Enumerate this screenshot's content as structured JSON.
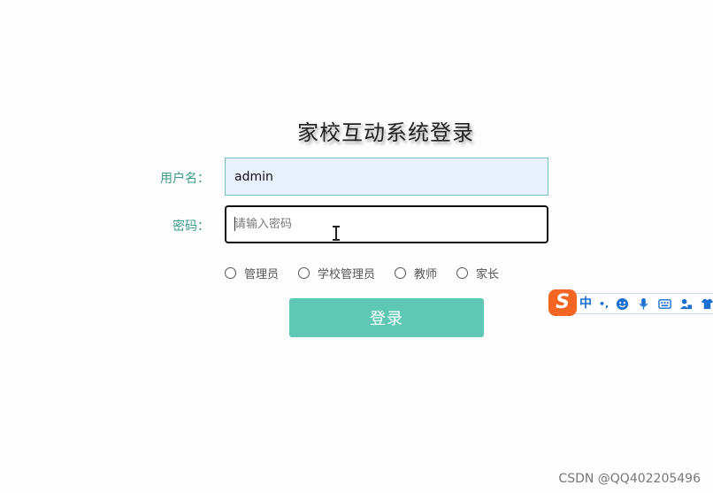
{
  "page": {
    "title": "家校互动系统登录"
  },
  "form": {
    "username_label": "用户名：",
    "username_value": "admin",
    "password_label": "密码：",
    "password_placeholder": "请输入密码",
    "password_value": ""
  },
  "roles": [
    {
      "label": "管理员",
      "checked": false
    },
    {
      "label": "学校管理员",
      "checked": false
    },
    {
      "label": "教师",
      "checked": false
    },
    {
      "label": "家长",
      "checked": false
    }
  ],
  "login_button": {
    "label": "登录"
  },
  "ime_toolbar": {
    "logo": "S",
    "mode": "中",
    "punct": "•,",
    "icons": [
      "emoji-icon",
      "microphone-icon",
      "keyboard-icon",
      "user-skin-icon",
      "shirt-icon"
    ]
  },
  "colors": {
    "accent": "#5ec8b4",
    "label_teal": "#3a9a8a",
    "autofill_bg": "#e8f0fe",
    "ime_orange": "#f26522",
    "ime_blue": "#1a6fd0"
  },
  "watermark": "CSDN @QQ402205496"
}
